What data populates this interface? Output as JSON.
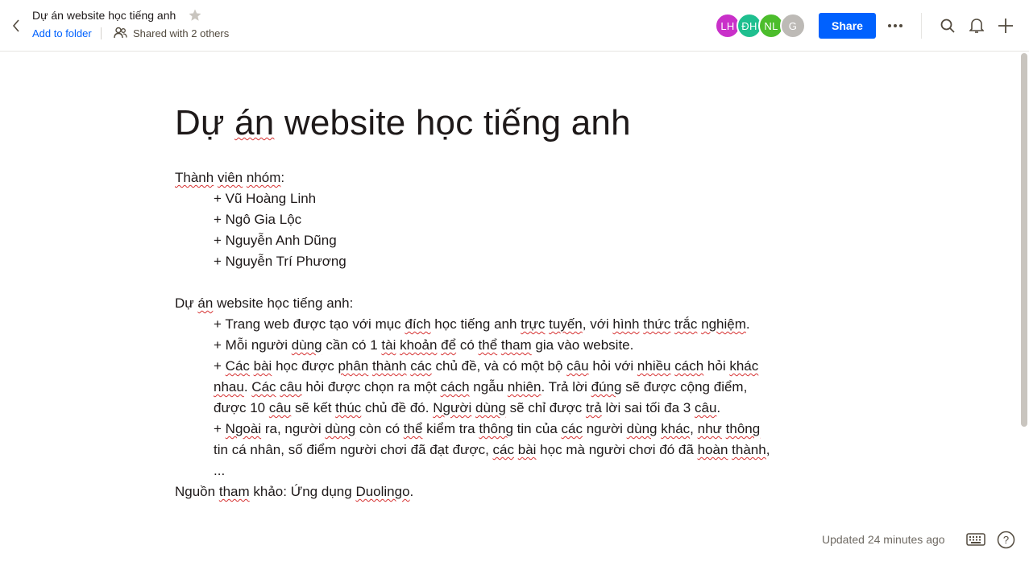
{
  "header": {
    "doc_title": "Dự án website học tiếng anh",
    "add_to_folder": "Add to folder",
    "shared_with": "Shared with 2 others",
    "share_label": "Share",
    "avatars": [
      {
        "initials": "LH",
        "color": "#c930c9"
      },
      {
        "initials": "ĐH",
        "color": "#1fbf8f"
      },
      {
        "initials": "NL",
        "color": "#4cbd2c"
      },
      {
        "initials": "G",
        "color": "#bdbab6"
      }
    ],
    "icons": [
      "back-arrow-icon",
      "star-icon",
      "people-icon",
      "more-icon",
      "search-icon",
      "bell-icon",
      "plus-icon"
    ]
  },
  "document": {
    "heading": "Dự án website học tiếng anh",
    "members_title": "Thành viên nhóm:",
    "members": [
      "+ Vũ Hoàng Linh",
      "+ Ngô Gia Lộc",
      "+ Nguyễn Anh Dũng",
      "+ Nguyễn Trí Phương"
    ],
    "project_title": "Dự án website học tiếng anh:",
    "bullets": [
      "+ Trang web được tạo với mục đích học tiếng anh trực tuyến, với hình thức trắc nghiệm.",
      "+ Mỗi người dùng cần có 1 tài khoản để có thể tham gia vào website.",
      "+ Các bài học được phân thành các chủ đề, và có một bộ câu hỏi với nhiều cách hỏi khác",
      "nhau. Các câu hỏi được chọn ra một cách ngẫu nhiên. Trả lời đúng sẽ được cộng điểm,",
      "được 10 câu sẽ kết thúc chủ đề đó. Người dùng sẽ chỉ được trả lời sai tối đa 3 câu.",
      "+ Ngoài ra, người dùng còn có thể kiểm tra thông tin của các người dùng khác, như thông",
      "tin cá nhân, số điểm người chơi đã đạt được, các bài học mà người chơi đó đã hoàn thành,",
      "..."
    ],
    "source": "Nguồn tham khảo: Ứng dụng Duolingo."
  },
  "footer": {
    "updated": "Updated 24 minutes ago"
  }
}
